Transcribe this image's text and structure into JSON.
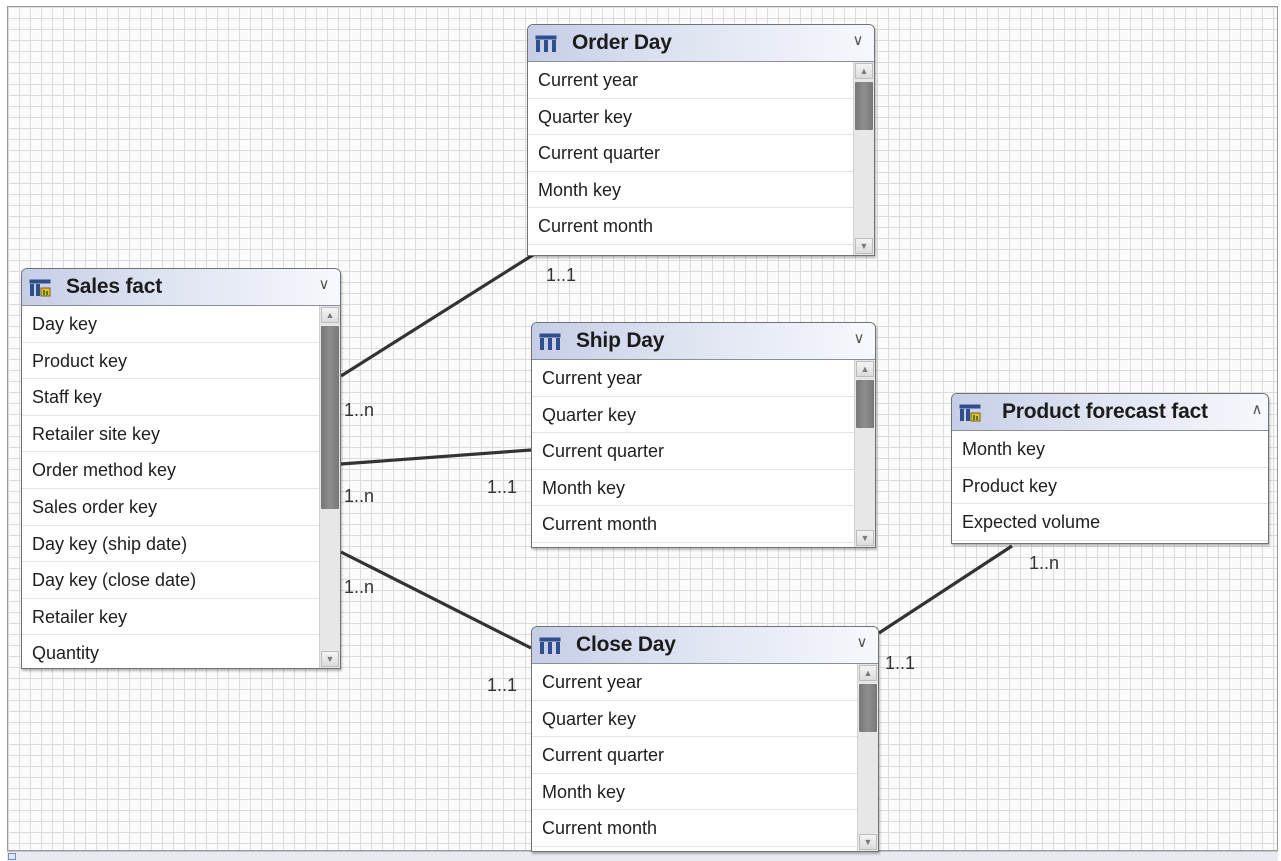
{
  "tables": {
    "sales_fact": {
      "title": "Sales fact",
      "icon": "fact-table-icon",
      "collapse_icon": "chevron-double-down-icon",
      "rows": [
        "Day key",
        "Product key",
        "Staff key",
        "Retailer site key",
        "Order method key",
        "Sales order key",
        "Day key (ship date)",
        "Day key (close date)",
        "Retailer key",
        "Quantity"
      ]
    },
    "order_day": {
      "title": "Order Day",
      "icon": "dimension-table-icon",
      "collapse_icon": "chevron-double-down-icon",
      "rows": [
        "Current year",
        "Quarter key",
        "Current quarter",
        "Month key",
        "Current month"
      ]
    },
    "ship_day": {
      "title": "Ship Day",
      "icon": "dimension-table-icon",
      "collapse_icon": "chevron-double-down-icon",
      "rows": [
        "Current year",
        "Quarter key",
        "Current quarter",
        "Month key",
        "Current month"
      ]
    },
    "close_day": {
      "title": "Close Day",
      "icon": "dimension-table-icon",
      "collapse_icon": "chevron-double-down-icon",
      "rows": [
        "Current year",
        "Quarter key",
        "Current quarter",
        "Month key",
        "Current month"
      ]
    },
    "product_forecast_fact": {
      "title": "Product forecast fact",
      "icon": "fact-table-icon",
      "collapse_icon": "chevron-double-up-icon",
      "rows": [
        "Month key",
        "Product key",
        "Expected volume"
      ]
    }
  },
  "relationships": {
    "sales_order": {
      "from_card": "1..n",
      "to_card": "1..1"
    },
    "sales_ship": {
      "from_card": "1..n",
      "to_card": "1..1"
    },
    "sales_close": {
      "from_card": "1..n",
      "to_card": "1..1"
    },
    "forecast_close": {
      "from_card": "1..n",
      "to_card": "1..1"
    }
  },
  "colors": {
    "header_gradient_start": "#c6cee6",
    "header_gradient_end": "#f7f8fc",
    "connector": "#333333",
    "scroll_thumb": "#808080",
    "grid_line": "#dcdcdc"
  }
}
